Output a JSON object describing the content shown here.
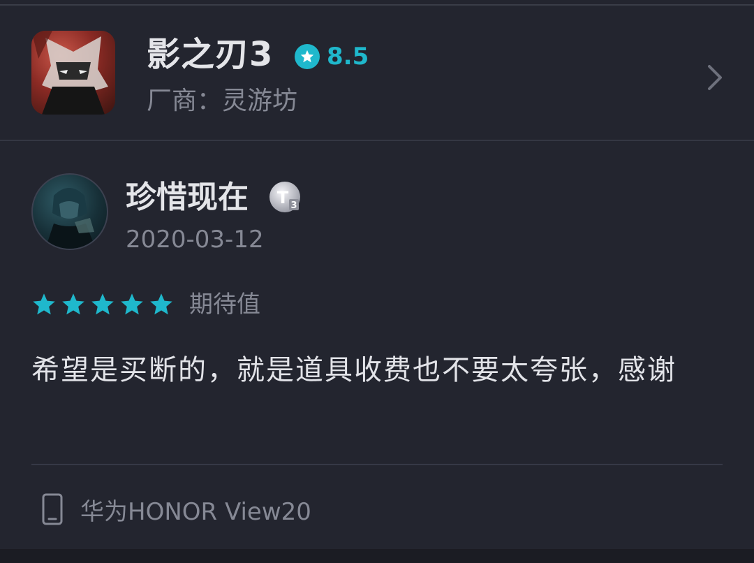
{
  "game": {
    "title": "影之刃3",
    "rating": "8.5",
    "publisher": "厂商：灵游坊",
    "icon": "game-icon"
  },
  "review": {
    "user_name": "珍惜现在",
    "level_badge": "T3",
    "date": "2020-03-12",
    "stars": 5,
    "rating_label": "期待值",
    "text": "希望是买断的，就是道具收费也不要太夸张，感谢",
    "device": "华为HONOR View20"
  },
  "colors": {
    "background": "#23252f",
    "accent": "#1fb8cc",
    "primary_text": "#e4e5e9",
    "secondary_text": "#868995"
  }
}
